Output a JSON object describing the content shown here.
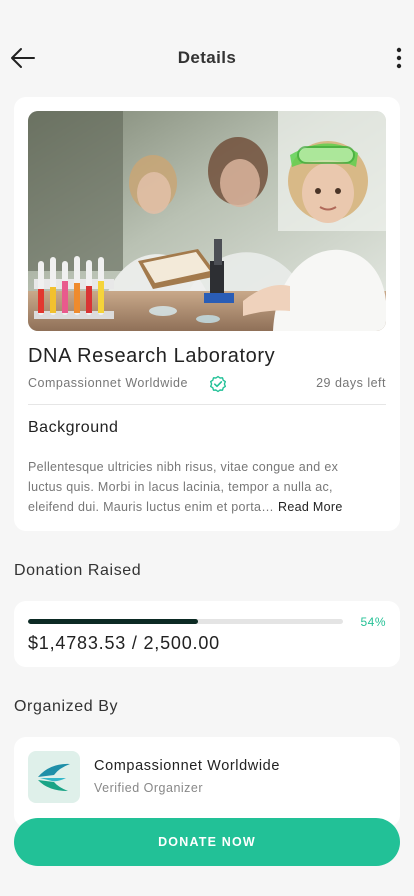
{
  "header": {
    "title": "Details",
    "back_icon": "arrow-left-icon",
    "more_icon": "more-vertical-icon"
  },
  "campaign": {
    "image_alt": "Children in a science laboratory",
    "title": "DNA Research Laboratory",
    "organizer": "Compassionnet Worldwide",
    "verified_icon": "verified-check-icon",
    "days_left": "29 days left",
    "background_heading": "Background",
    "background_lines": [
      "Pellentesque ultricies nibh risus, vitae congue and ex",
      "luctus quis. Morbi in lacus lacinia, tempor a nulla ac,",
      "eleifend dui. Mauris luctus enim et porta…"
    ],
    "read_more": "Read More"
  },
  "donation": {
    "section_title": "Donation Raised",
    "percent_label": "54%",
    "progress_fraction": 0.54,
    "amount": "$1,4783.53 / 2,500.00"
  },
  "organizer_section": {
    "section_title": "Organized By",
    "name": "Compassionnet Worldwide",
    "status": "Verified Organizer",
    "logo_icon": "organizer-logo-icon"
  },
  "cta": {
    "donate_label": "DONATE NOW"
  },
  "colors": {
    "accent": "#22c197",
    "progress_fill": "#0c2a24",
    "background": "#f6f6f6"
  }
}
